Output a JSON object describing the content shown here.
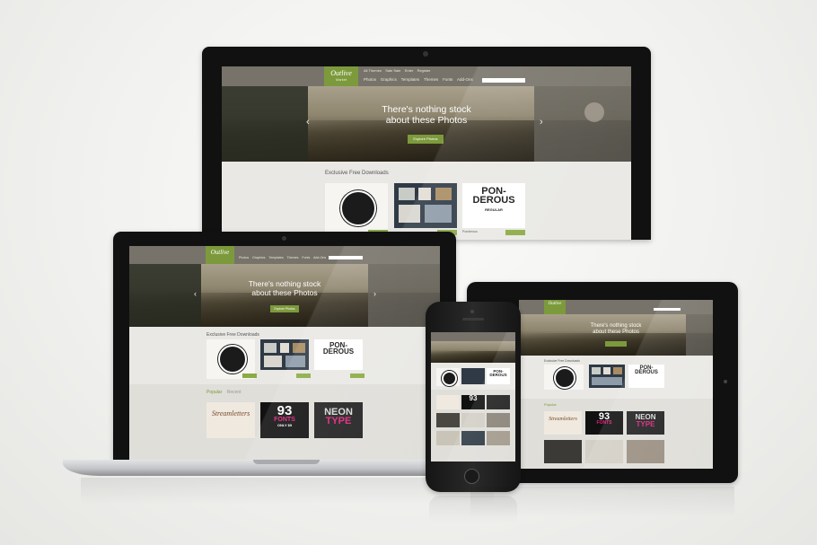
{
  "site": {
    "logo": "Outlive",
    "logo_sub": "Market",
    "top_links": [
      "All Themes",
      "Sale Sale",
      "Enter",
      "Register"
    ],
    "menu": [
      "Photos",
      "Graphics",
      "Templates",
      "Themes",
      "Fonts",
      "Add-Ons"
    ],
    "hero_line1": "There's nothing stock",
    "hero_line2": "about these Photos",
    "hero_button": "Explore Photos",
    "section_title": "Exclusive Free Downloads",
    "popular_title": "Popular",
    "recent_title": "Recent",
    "product_ponderous_line1": "PON-",
    "product_ponderous_line2": "DEROUS",
    "product_ponderous_sub": "REGULAR",
    "product_ponderous_name": "Ponderous",
    "product_fonts_number": "93",
    "product_fonts_word": "FONTS",
    "product_fonts_tag": "ONLY $9",
    "product_neon_line1": "NEON",
    "product_neon_line2": "TYPE",
    "product_script": "Streamletters"
  },
  "colors": {
    "accent_green": "#7c9a3c",
    "topbar": "#77736a",
    "device_bezel": "#111111",
    "laptop_body": "#c9cacc",
    "background": "#f1f1ef"
  },
  "icons": [
    "camera-icon",
    "home-button-icon",
    "arrow-left-icon",
    "arrow-right-icon"
  ]
}
